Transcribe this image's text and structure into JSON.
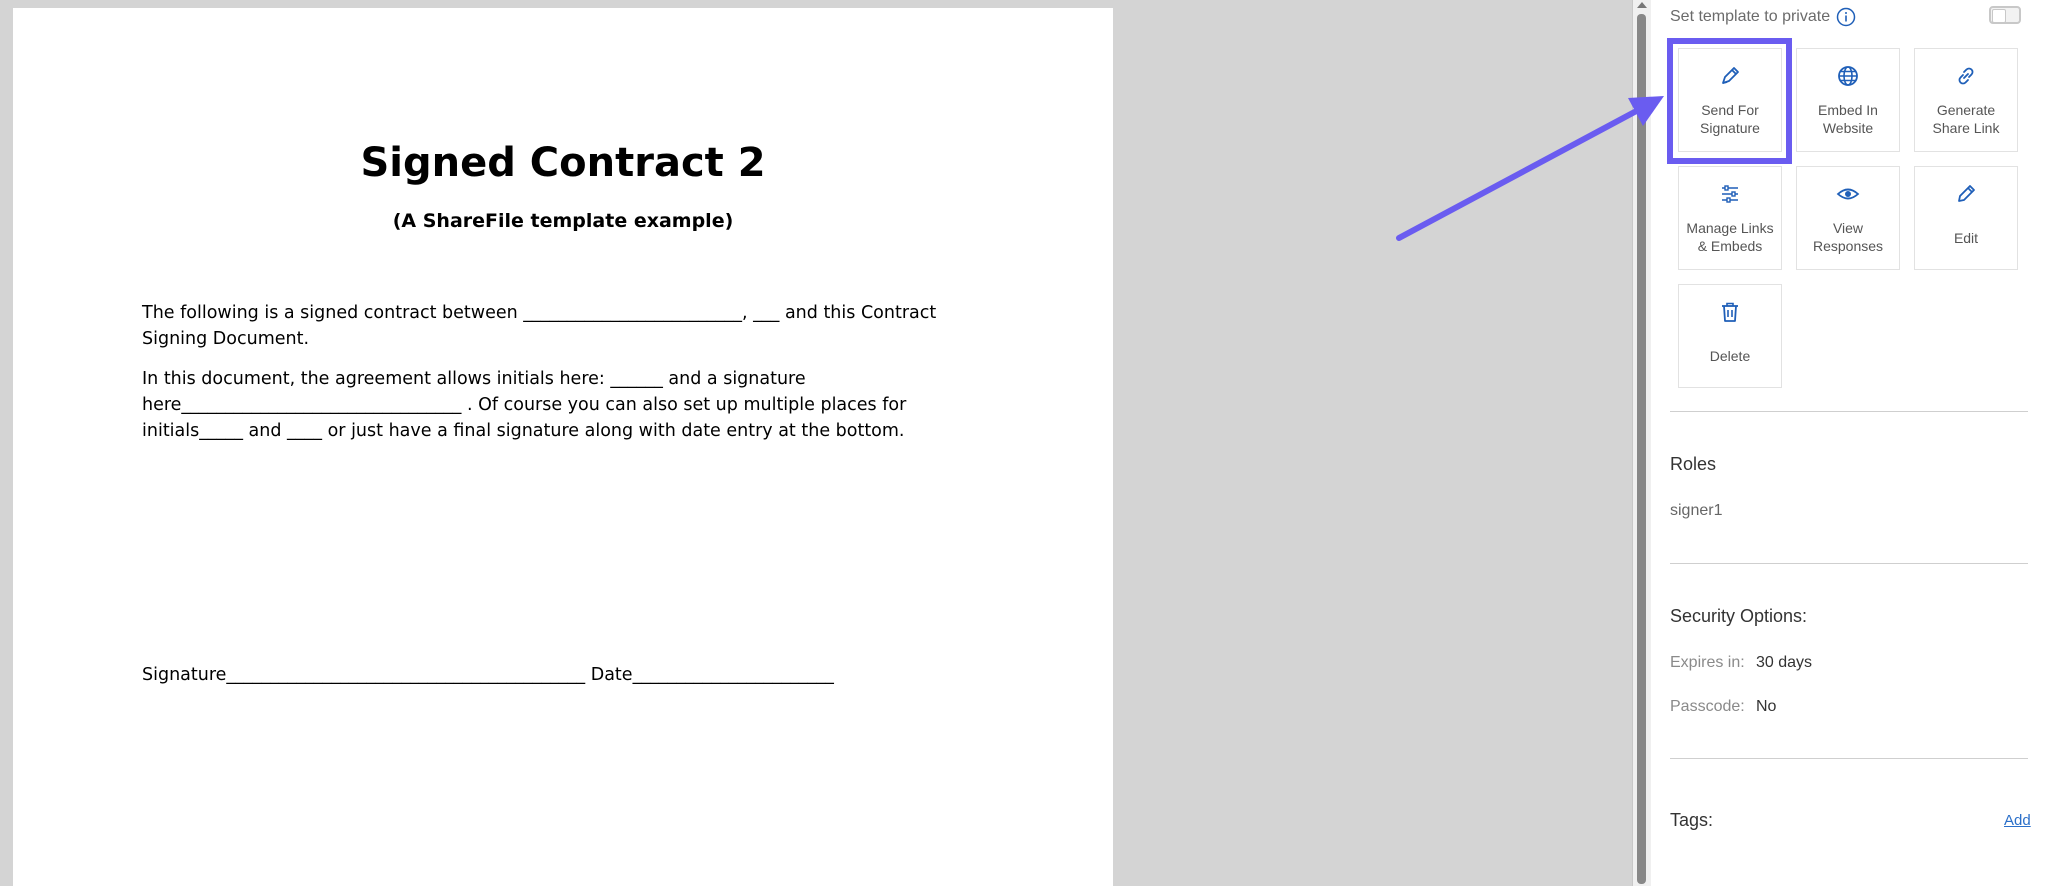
{
  "document": {
    "title": "Signed Contract 2",
    "subtitle": "(A ShareFile template example)",
    "para1": "The following is a signed contract between _________________________, ___ and this Contract Signing Document.",
    "para2": "In this document, the agreement allows initials here: ______ and a signature here________________________________ . Of course you can also set up multiple places for initials_____ and ____ or just have a final signature along with date entry at the bottom.",
    "signature_line": "Signature_________________________________________ Date_______________________"
  },
  "panel": {
    "private_label": "Set template to private",
    "private_enabled": false,
    "actions": [
      {
        "label_line1": "Send For",
        "label_line2": "Signature",
        "icon": "pen-icon"
      },
      {
        "label_line1": "Embed In",
        "label_line2": "Website",
        "icon": "globe-icon"
      },
      {
        "label_line1": "Generate",
        "label_line2": "Share Link",
        "icon": "link-icon"
      },
      {
        "label_line1": "Manage Links",
        "label_line2": "& Embeds",
        "icon": "sliders-icon"
      },
      {
        "label_line1": "View",
        "label_line2": "Responses",
        "icon": "eye-icon"
      },
      {
        "label_line1": "Edit",
        "label_line2": "",
        "icon": "pencil-icon"
      },
      {
        "label_line1": "Delete",
        "label_line2": "",
        "icon": "trash-icon"
      }
    ],
    "roles_title": "Roles",
    "roles": [
      "signer1"
    ],
    "security_title": "Security Options:",
    "security": {
      "expires_label": "Expires in:",
      "expires_value": "30 days",
      "passcode_label": "Passcode:",
      "passcode_value": "No"
    },
    "tags_title": "Tags:",
    "tags_add": "Add"
  },
  "colors": {
    "accent": "#1f5fb8",
    "highlight": "#6a5cf0",
    "link": "#2a6fc9"
  }
}
